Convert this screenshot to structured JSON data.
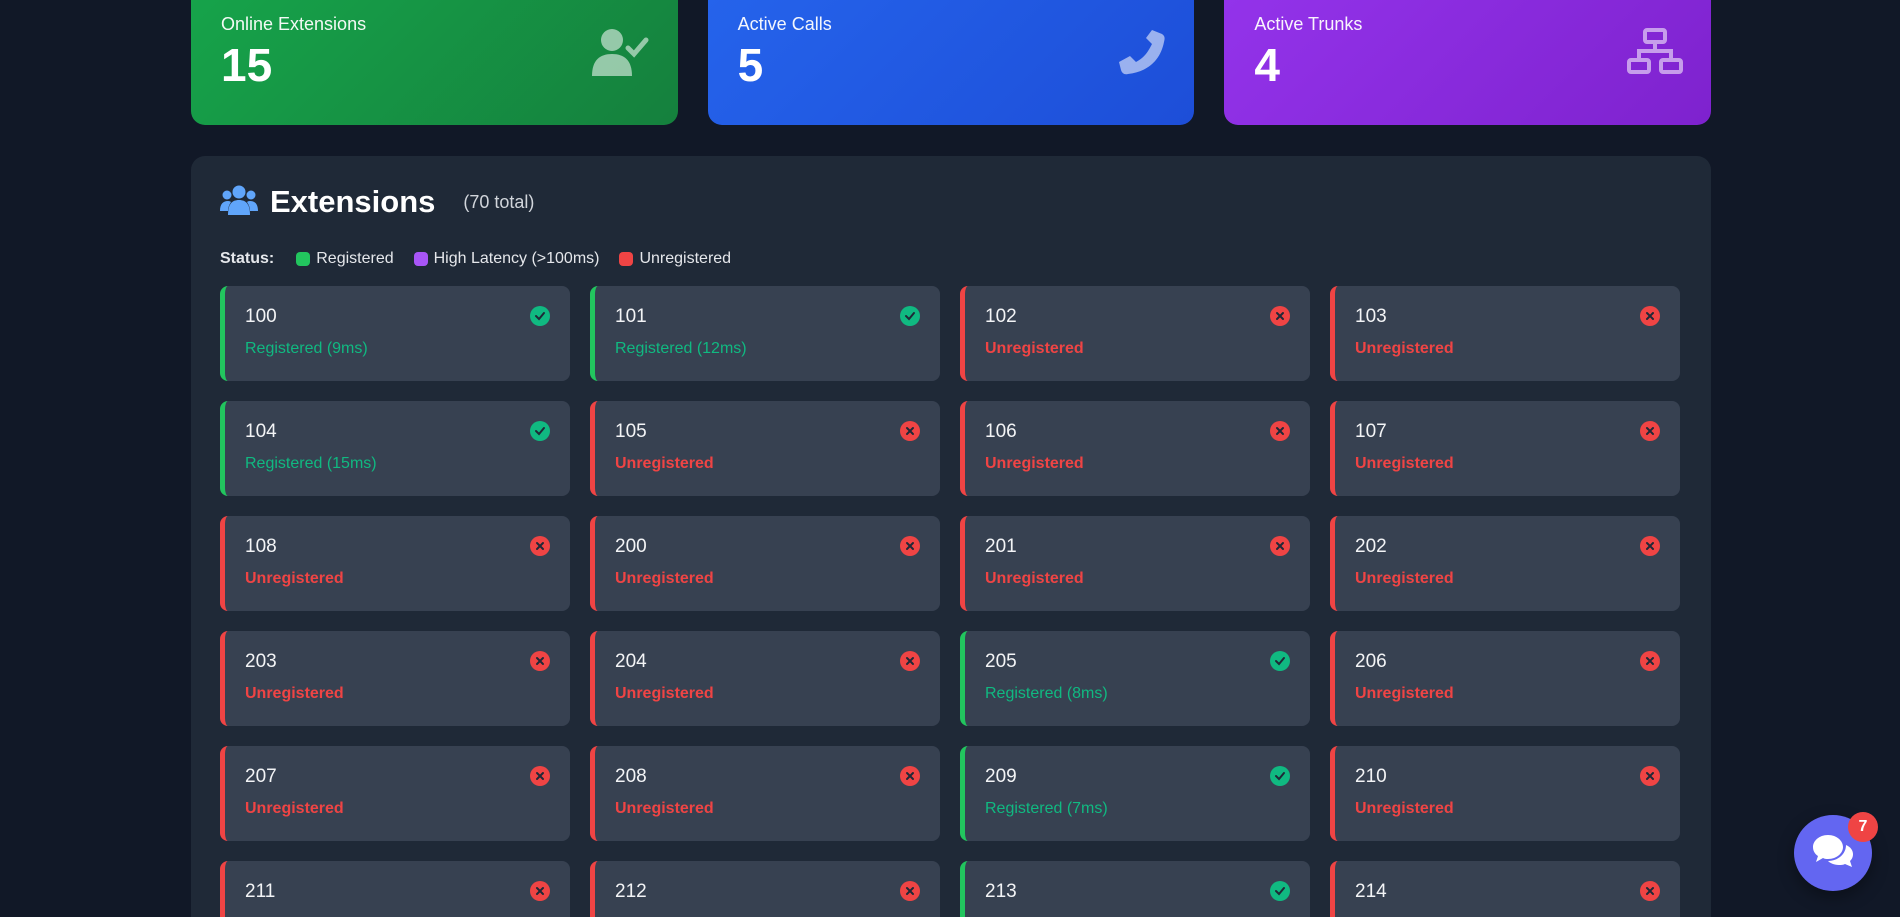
{
  "stats": [
    {
      "label": "Online Extensions",
      "value": "15",
      "icon": "user-check-icon",
      "color": "#16a34a"
    },
    {
      "label": "Active Calls",
      "value": "5",
      "icon": "phone-icon",
      "color": "#2563eb"
    },
    {
      "label": "Active Trunks",
      "value": "4",
      "icon": "network-icon",
      "color": "#9333ea"
    }
  ],
  "extensions": {
    "title": "Extensions",
    "count": "(70 total)",
    "icon": "users-icon"
  },
  "legend": {
    "title": "Status:",
    "items": [
      {
        "label": "Registered",
        "color": "#22c55e"
      },
      {
        "label": "High Latency (>100ms)",
        "color": "#a855f7"
      },
      {
        "label": "Unregistered",
        "color": "#ef4444"
      }
    ]
  },
  "cards": [
    {
      "num": "100",
      "status": "Registered (9ms)",
      "ok": true
    },
    {
      "num": "101",
      "status": "Registered (12ms)",
      "ok": true
    },
    {
      "num": "102",
      "status": "Unregistered",
      "ok": false
    },
    {
      "num": "103",
      "status": "Unregistered",
      "ok": false
    },
    {
      "num": "104",
      "status": "Registered (15ms)",
      "ok": true
    },
    {
      "num": "105",
      "status": "Unregistered",
      "ok": false
    },
    {
      "num": "106",
      "status": "Unregistered",
      "ok": false
    },
    {
      "num": "107",
      "status": "Unregistered",
      "ok": false
    },
    {
      "num": "108",
      "status": "Unregistered",
      "ok": false
    },
    {
      "num": "200",
      "status": "Unregistered",
      "ok": false
    },
    {
      "num": "201",
      "status": "Unregistered",
      "ok": false
    },
    {
      "num": "202",
      "status": "Unregistered",
      "ok": false
    },
    {
      "num": "203",
      "status": "Unregistered",
      "ok": false
    },
    {
      "num": "204",
      "status": "Unregistered",
      "ok": false
    },
    {
      "num": "205",
      "status": "Registered (8ms)",
      "ok": true
    },
    {
      "num": "206",
      "status": "Unregistered",
      "ok": false
    },
    {
      "num": "207",
      "status": "Unregistered",
      "ok": false
    },
    {
      "num": "208",
      "status": "Unregistered",
      "ok": false
    },
    {
      "num": "209",
      "status": "Registered (7ms)",
      "ok": true
    },
    {
      "num": "210",
      "status": "Unregistered",
      "ok": false
    },
    {
      "num": "211",
      "status": "",
      "ok": false
    },
    {
      "num": "212",
      "status": "",
      "ok": false
    },
    {
      "num": "213",
      "status": "",
      "ok": true
    },
    {
      "num": "214",
      "status": "",
      "ok": false
    }
  ],
  "chat": {
    "badge": "7",
    "icon": "chat-bubbles-icon"
  }
}
